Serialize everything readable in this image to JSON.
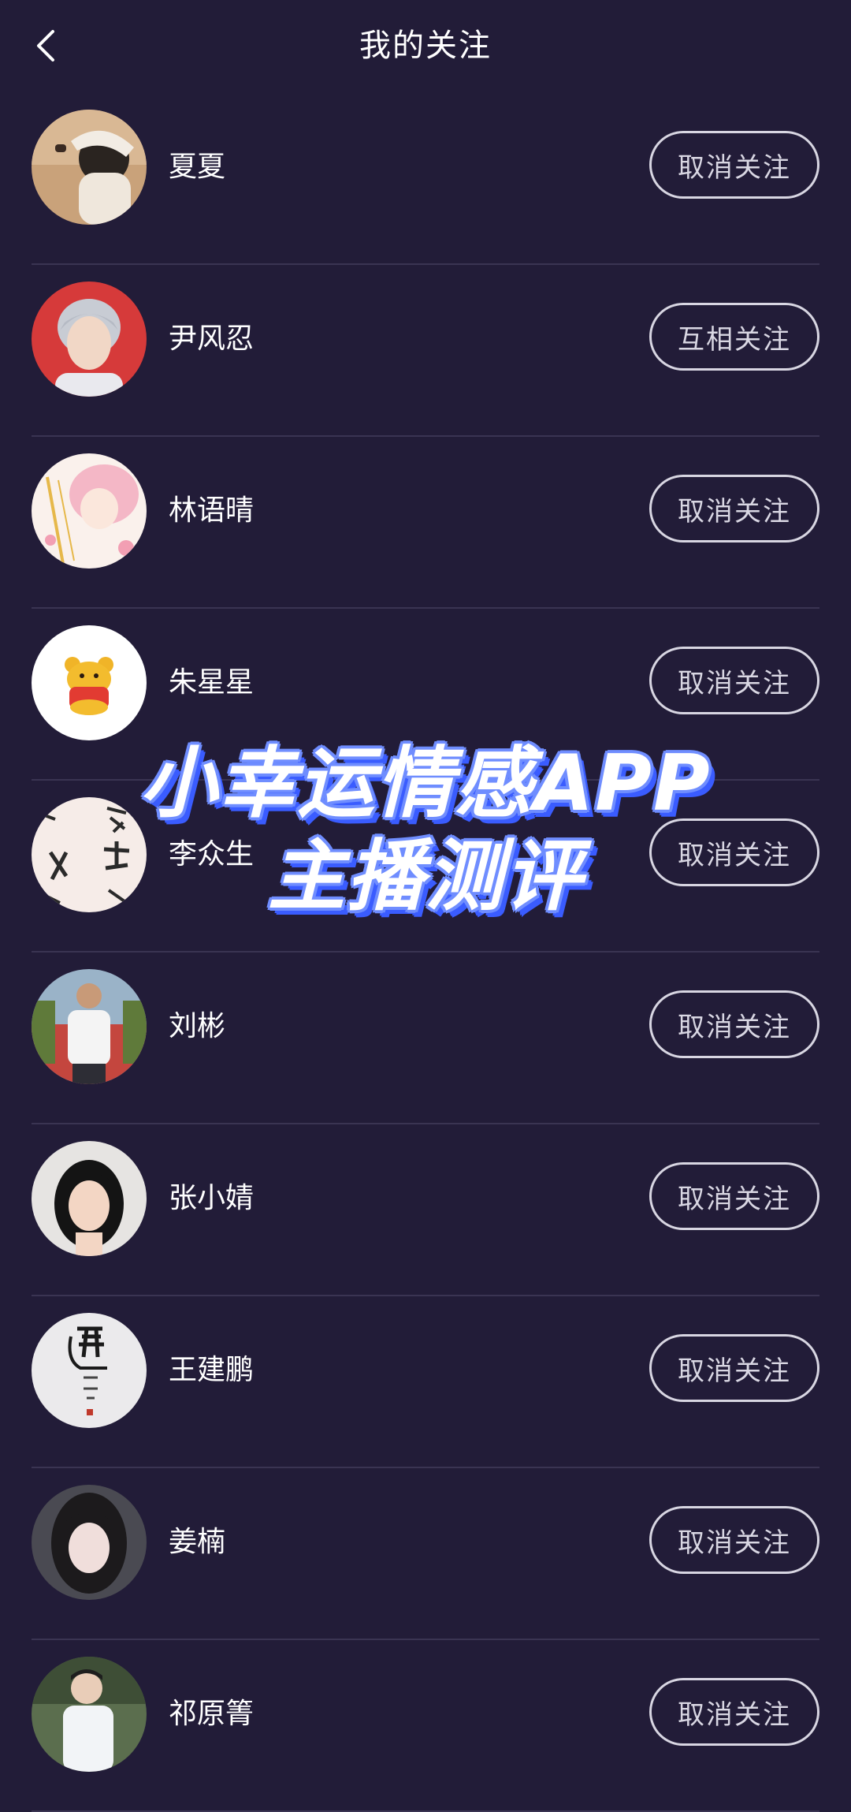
{
  "header": {
    "title": "我的关注",
    "back_icon": "chevron-left-icon"
  },
  "follows": [
    {
      "name": "夏夏",
      "action": "取消关注",
      "avatar": "avatar-photo-girl-hat"
    },
    {
      "name": "尹风忍",
      "action": "互相关注",
      "avatar": "avatar-photo-boy-red-bg"
    },
    {
      "name": "林语晴",
      "action": "取消关注",
      "avatar": "avatar-illustration-pink-hair"
    },
    {
      "name": "朱星星",
      "action": "取消关注",
      "avatar": "avatar-cartoon-bear"
    },
    {
      "name": "李众生",
      "action": "取消关注",
      "avatar": "avatar-calligraphy"
    },
    {
      "name": "刘彬",
      "action": "取消关注",
      "avatar": "avatar-photo-man-outdoors"
    },
    {
      "name": "张小婧",
      "action": "取消关注",
      "avatar": "avatar-photo-woman"
    },
    {
      "name": "王建鹏",
      "action": "取消关注",
      "avatar": "avatar-calligraphy-dao"
    },
    {
      "name": "姜楠",
      "action": "取消关注",
      "avatar": "avatar-photo-woman-dark-hair"
    },
    {
      "name": "祁原箐",
      "action": "取消关注",
      "avatar": "avatar-photo-man-white-shirt"
    }
  ],
  "overlay": {
    "line1": "小幸运情感APP",
    "line2": "主播测评"
  },
  "colors": {
    "background": "#221c38",
    "divider": "#3a3452",
    "button_border": "#d8d6e2",
    "overlay_outline": "#6f8dff"
  }
}
